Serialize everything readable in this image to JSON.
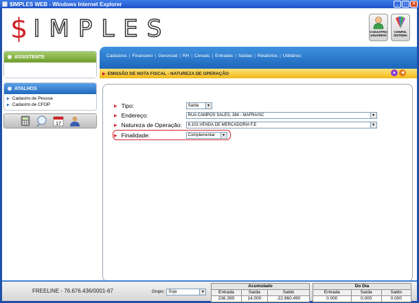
{
  "window": {
    "title": "$IMPLES WEB - Windows Internet Explorer"
  },
  "logo": {
    "dollar": "$",
    "text": "IMPLES"
  },
  "header_buttons": [
    {
      "label": "CADASTRO USUÁRIOS"
    },
    {
      "label": "CONFIG. SISTEMA"
    }
  ],
  "sidebar": {
    "assistente": "ASSISTENTE",
    "atalhos": "ATALHOS",
    "shortcuts": [
      "Cadastro de Pessoa",
      "Cadastro de CFOP"
    ]
  },
  "menu": [
    "Cadastros",
    "Financeiro",
    "Gerencial",
    "RH",
    "Cereais",
    "Entradas",
    "Saídas",
    "Relatórios",
    "Utilitários"
  ],
  "content": {
    "title": "EMISSÃO DE NOTA FISCAL - NATUREZA DE OPERAÇÃO"
  },
  "form": {
    "tipo_label": "Tipo:",
    "tipo_value": "Saída",
    "endereco_label": "Endereço:",
    "endereco_value": "RUA CAMPOS SALES, 384 - MAFRA/SC",
    "natureza_label": "Natureza de Operação:",
    "natureza_value": "6.102-VENDA DE MERCADORIA F.E",
    "finalidade_label": "Finalidade:",
    "finalidade_value": "Complementar"
  },
  "footer": {
    "freeline": "FREELINE - 76.676.436/0001-67",
    "grupo_label": "Grupo:",
    "grupo_value": "Soja",
    "acumulado": {
      "title": "Acumulado",
      "headers": [
        "Entrada",
        "Saída",
        "Saldo"
      ],
      "values": [
        "236.399",
        "14.000",
        "-22.860.490"
      ]
    },
    "dodia": {
      "title": "Do Dia",
      "headers": [
        "Entrada",
        "Saída",
        "Saldo"
      ],
      "values": [
        "0.000",
        "0.000",
        "0.000"
      ]
    }
  },
  "colors": {
    "brand_red": "#d0232a",
    "menu_blue": "#1a63b9",
    "header_yellow": "#f2b817",
    "assist_green": "#6e9d2d"
  }
}
